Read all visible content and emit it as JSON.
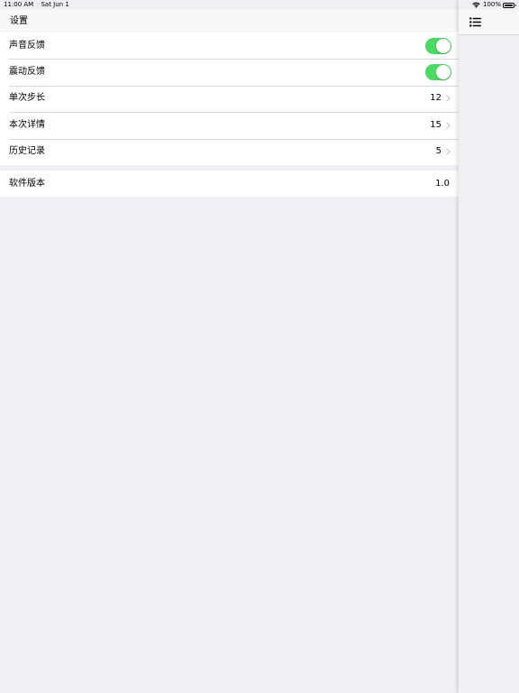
{
  "status_bar": {
    "time": "11:00 AM",
    "date": "Sat Jun 1",
    "battery": "100%"
  },
  "nav": {
    "title": "设置"
  },
  "settings": {
    "sound_feedback": {
      "label": "声音反馈",
      "on": true
    },
    "vibration_feedback": {
      "label": "震动反馈",
      "on": true
    },
    "step_size": {
      "label": "单次步长",
      "value": "12"
    },
    "session_details": {
      "label": "本次详情",
      "value": "15"
    },
    "history": {
      "label": "历史记录",
      "value": "5"
    },
    "version": {
      "label": "软件版本",
      "value": "1.0"
    }
  },
  "colors": {
    "toggle_on": "#4cd964",
    "background": "#efeff4"
  },
  "icons": {
    "menu": "list-icon",
    "disclosure": "chevron-right-icon"
  }
}
